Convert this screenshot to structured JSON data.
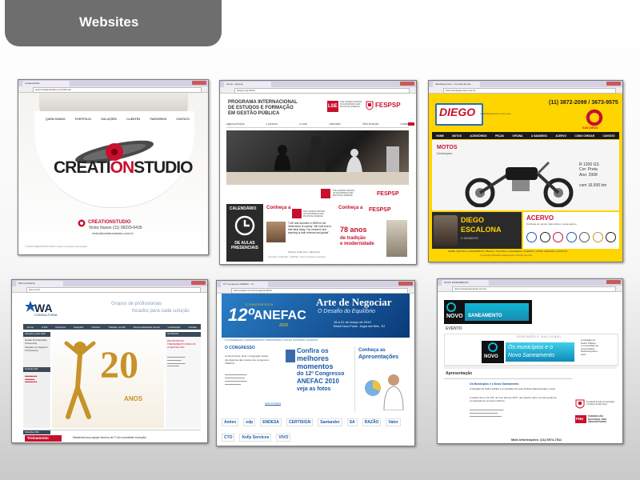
{
  "slide": {
    "title": "Websites"
  },
  "creation": {
    "tab": "creationstudio",
    "url": "www.creationstudio.com.br/home/",
    "nav": [
      "QUEM SOMOS",
      "PORTFÓLIO",
      "SOLUÇÕES",
      "CLIENTES",
      "PARCEIROS",
      "CONTATO"
    ],
    "logo_a": "CREATI",
    "logo_b": "ON",
    "logo_c": "STUDIO",
    "brand": "CREATIONSTUDIO",
    "contact_name": "Victor Nunes (11) 99229-6439",
    "contact_email": "victor@creationstudio.com.br",
    "footer": "© 2013 CREATIONSTUDIO | Todos os direitos reservados"
  },
  "lse": {
    "tab": "Home - Fespsp",
    "url": "fespsp.org.br/lse/",
    "title": "PROGRAMA INTERNACIONAL\nDE ESTUDOS E FORMAÇÃO\nEM GESTÃO PÚBLICA",
    "lse": "LSE",
    "lse_sub": "THE LONDON SCHOOL\nOF ECONOMICS AND\nPOLITICAL SCIENCE",
    "fespsp": "FESPSP",
    "nav": [
      "página principal",
      "o parceria",
      "o curso",
      "calendário",
      "ficha inscrição",
      "contato"
    ],
    "calendario": "CALENDÁRIO",
    "aulas": "DE AULAS\nPRESENCIAIS",
    "conheca": "Conheça a",
    "quote": "\"LSE was founded in 1895 for the 'betterment of society'. We hold true to that ideal today. Our research and teaching is both relevant and global\"",
    "professor": "Professor Judith Rees, LSE Director",
    "anos_big": "78 anos",
    "anos_sub": "de tradição\ne modernidade",
    "footer": "Copyright © 2009-2011 - FESPSP - Todos os direitos reservados"
  },
  "sandiego": {
    "tab": "Sandiegomotos - O portal da sua...",
    "url": "www.sandiegomotos.com.br",
    "phones": "(11) 3872-2099 / 3673-9575",
    "logo": "DIEGO",
    "logo_tag": "a sandiegomotos a sua moto",
    "badge": "SAN DIEGO",
    "nav": [
      "HOME",
      "MOTOS",
      "ACESSÓRIOS",
      "PEÇAS",
      "OFICINA",
      "A SANDIEGO",
      "ACERVO",
      "COMO CHEGAR",
      "CONTATO"
    ],
    "motos": "MOTOS",
    "destaques": "Destaques",
    "model": "R 1200 GS\nCor: Preta\nAno: 2008",
    "km": "com 16.500 km",
    "diego": "DIEGO",
    "escalona": "ESCALONA",
    "escalona_sub": "O SANDIEGO",
    "acervo": "ACERVO",
    "acervo_sub": "Conheça um pouco mais sobre o nosso acervo",
    "footer_nav": "HOME | MOTOS | ACESSÓRIOS | PEÇAS | OFICINA | A SANDIEGO | ACERVO | COMO CHEGAR | CONTATO",
    "copyright": "© Copyright 2009-2013 sandiegomotos. All rights reserved."
  },
  "wa": {
    "tab": "WA Consultoria",
    "url": "wa.com.br",
    "logo": "WA",
    "logo_sub": "CONSULTORIA",
    "tagline1": "Grupos de profissionais",
    "tagline2": "focados para cada solução",
    "nav": [
      "Home",
      "A WA",
      "Parceiros",
      "Soluções",
      "Clientes",
      "Trabalhe na WA",
      "Responsabilidade Social",
      "Localização",
      "Contato"
    ],
    "side_head": "Soluções para SAP",
    "side_items": [
      "Gestão Previdenciária",
      "Outsourcing",
      "Soluções em Negócios",
      "Treinamentos"
    ],
    "news_head": "Notícias WA",
    "big": "20",
    "anos": "ANOS",
    "right_head": "NOTÍCIAS",
    "right_red": "WA PROMOVE TREINAMENTO PARA OS CLIENTES SAP",
    "bottom_head": "Soluções WA",
    "treinamento": "Treinamento",
    "bottom_text": "Mantenha sua equipe técnica de TI em constante evolução."
  },
  "anefac": {
    "tab": "12º Congresso ANEFAC - O...",
    "url": "www.anefac.com.br/congresso2010",
    "arte": "Arte de Negociar",
    "desafio": "O Desafio do Equilíbrio",
    "congresso": "CONGRESSO",
    "twelve": "12º",
    "brand": "ANEFAC",
    "year": "2010",
    "dates": "18 a 21 de março de 2010",
    "location": "Resort Novo Prado - Angra dos Reis - RJ",
    "nav": "O CONGRESSO | PALESTRANTES | PATROCÍNIOS | FOTOS | DÚVIDAS | CONTATO",
    "section": "O CONGRESSO",
    "body": "Conhecimento, lazer e integração. Estas são algumas das marcas dos congressos ANEFAC...",
    "link": "Leia na íntegra",
    "confira": "Confira os",
    "melhores": "melhores",
    "momentos": "momentos",
    "do12": "do 12º Congresso",
    "anefac2010": "ANEFAC 2010",
    "veja": "veja as fotos",
    "conheca": "Conheça as",
    "apresentacoes": "Apresentações",
    "sponsors": [
      "Amtev",
      "edp",
      "ENDESA",
      "CERTISIGN",
      "Santander",
      "SA",
      "RAZÃO",
      "Valor",
      "CTO",
      "Kelly Services",
      "VIVO"
    ]
  },
  "novo": {
    "tab": "NOVO SANEAMENTO",
    "url": "www.novosaneamento.com.br",
    "novo": "NOVO",
    "saneamento": "SANEAMENTO",
    "evento": "EVENTO",
    "seminario": "SEMINÁRIO NACIONAL",
    "headline": "Os municípios e o",
    "headline2": "Novo Saneamento",
    "side_text": "A situação do\nPoder Público\ne os desafios da\nnova Política\nNacional para o\nsetor",
    "apresentacao": "Apresentação",
    "item_title": "Os Municípios e o Novo Saneamento",
    "item_sub": "A situação do Poder público e os desafios da nova Política Nacional para o setor",
    "paragraph": "A edição da Lei 11.445, de 5 de abril de 2007, que dispõe sobre normas gerais de contratação de serviços públicos...",
    "fundacao": "Fundação Escola de Sociologia e Política de São Paulo",
    "fnu": "FNU",
    "federacao": "FEDERAÇÃO\nNACIONAL DOS\nURBANITÁRIOS",
    "phone": "Mais informações: (11) 5574-7511"
  },
  "colors": {
    "slide_tab": "#6e6e6e",
    "lse_red": "#c8102e",
    "sandiego_yellow": "#ffd500",
    "anefac_blue": "#1a5aa8",
    "wa_gold": "#c8922a",
    "novo_cyan": "#0fb7d6"
  }
}
